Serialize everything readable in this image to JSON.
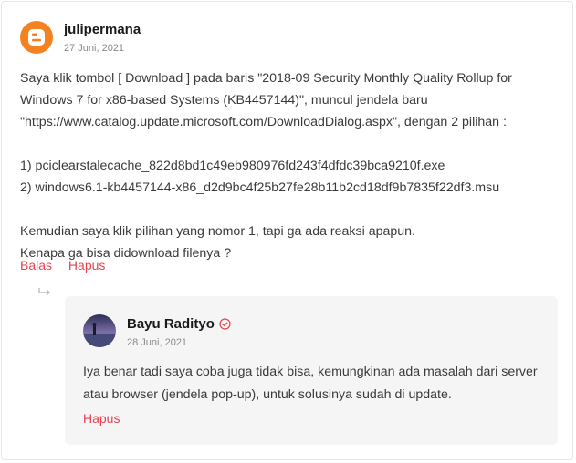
{
  "comment": {
    "author": "julipermana",
    "date": "27 Juni, 2021",
    "avatar_icon": "blogger-icon",
    "avatar_color": "#f58220",
    "paragraphs": [
      "Saya klik tombol [ Download ] pada baris \"2018-09 Security Monthly Quality Rollup for Windows 7 for x86-based Systems (KB4457144)\", muncul jendela baru \"https://www.catalog.update.microsoft.com/DownloadDialog.aspx\", dengan 2 pilihan :",
      "1) pciclearstalecache_822d8bd1c49eb980976fd243f4dfdc39bca9210f.exe",
      "2) windows6.1-kb4457144-x86_d2d9bc4f25b27fe28b11b2cd18df9b7835f22df3.msu",
      "Kemudian saya klik pilihan yang nomor 1, tapi ga ada reaksi apapun.",
      "Kenapa ga bisa didownload filenya ?"
    ],
    "actions": {
      "reply": "Balas",
      "delete": "Hapus"
    }
  },
  "reply": {
    "author": "Bayu Radityo",
    "verified_icon": "verified-check-icon",
    "date": "28 Juni, 2021",
    "text": "Iya benar tadi saya coba juga tidak bisa, kemungkinan ada masalah dari server atau browser (jendela pop-up), untuk solusinya sudah di update.",
    "actions": {
      "delete": "Hapus"
    }
  },
  "colors": {
    "accent": "#e8424f",
    "reply_bg": "#f5f5f5"
  }
}
